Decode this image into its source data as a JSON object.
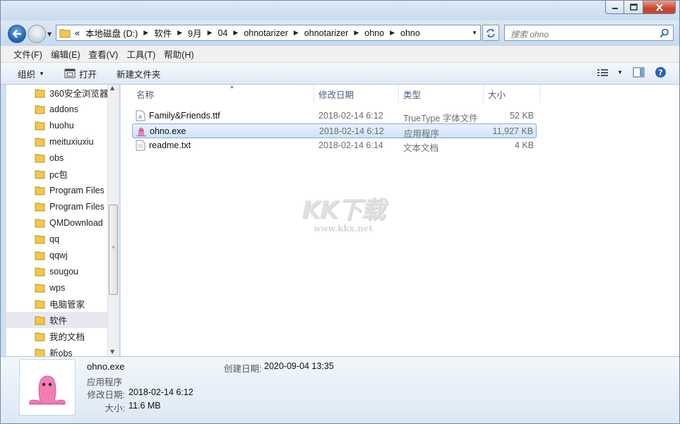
{
  "window": {
    "controls": {
      "minimize": "minimize",
      "maximize": "maximize",
      "close": "close"
    }
  },
  "address": {
    "overflow_marker": "«",
    "crumbs": [
      "本地磁盘 (D:)",
      "软件",
      "9月",
      "04",
      "ohnotarizer",
      "ohnotarizer",
      "ohno",
      "ohno"
    ],
    "search_placeholder": "搜索 ohno"
  },
  "menu": {
    "items": [
      "文件(F)",
      "编辑(E)",
      "查看(V)",
      "工具(T)",
      "帮助(H)"
    ]
  },
  "toolbar": {
    "organize": "组织",
    "open": "打开",
    "new_folder": "新建文件夹"
  },
  "nav_tree": {
    "items": [
      "360安全浏览器",
      "addons",
      "huohu",
      "meituxiuxiu",
      "obs",
      "pc包",
      "Program Files",
      "Program Files",
      "QMDownload",
      "qq",
      "qqwj",
      "sougou",
      "wps",
      "电脑管家",
      "软件",
      "我的文档",
      "新obs"
    ],
    "selected_index": 14
  },
  "file_list": {
    "columns": {
      "name": "名称",
      "date": "修改日期",
      "type": "类型",
      "size": "大小"
    },
    "rows": [
      {
        "name": "Family&Friends.ttf",
        "date": "2018-02-14 6:12",
        "type": "TrueType 字体文件",
        "size": "52 KB",
        "icon": "font-file-icon"
      },
      {
        "name": "ohno.exe",
        "date": "2018-02-14 6:12",
        "type": "应用程序",
        "size": "11,927 KB",
        "icon": "pink-blob-app-icon",
        "selected": true
      },
      {
        "name": "readme.txt",
        "date": "2018-02-14 6:14",
        "type": "文本文档",
        "size": "4 KB",
        "icon": "text-file-icon"
      }
    ]
  },
  "watermark": {
    "logo": "KK下载",
    "url": "www.kkx.net"
  },
  "details": {
    "name": "ohno.exe",
    "type": "应用程序",
    "modified_label": "修改日期:",
    "modified_value": "2018-02-14 6:12",
    "size_label": "大小:",
    "size_value": "11.6 MB",
    "created_label": "创建日期:",
    "created_value": "2020-09-04 13:35"
  },
  "colors": {
    "selection_border": "#84acdd",
    "pink_icon": "#f27fb4"
  }
}
